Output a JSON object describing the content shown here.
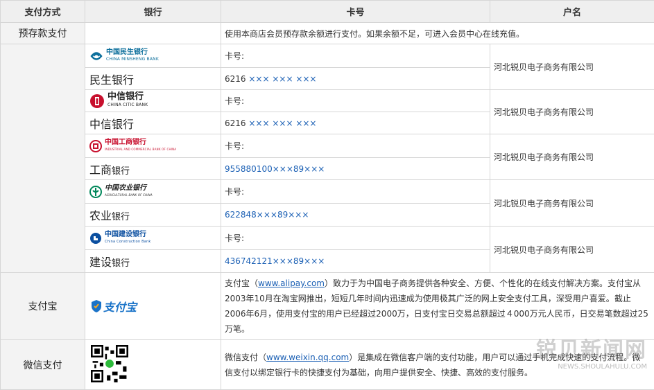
{
  "headers": [
    "支付方式",
    "银行",
    "卡号",
    "户名"
  ],
  "prepaid": {
    "method": "预存款支付",
    "desc": "使用本商店会员预存款余额进行支付。如果余额不足，可进入会员中心在线充值。"
  },
  "card_label": "卡号:",
  "banks": [
    {
      "logo_cn": "中国民生银行",
      "logo_en": "CHINA MINSHENG BANK",
      "name_big": "民生",
      "name_small": "银行",
      "card_prefix": "6216 ",
      "card_mask": "××× ××× ×××",
      "company": "河北锐贝电子商务有限公司",
      "color": "#0b6e9b"
    },
    {
      "logo_cn": "中信银行",
      "logo_en": "CHINA CITIC BANK",
      "name_big": "中信",
      "name_small": "银行",
      "card_prefix": "6216 ",
      "card_mask": "××× ××× ×××",
      "company": "河北锐贝电子商务有限公司",
      "color": "#c8102e"
    },
    {
      "logo_cn": "中国工商银行",
      "logo_en": "INDUSTRIAL AND COMMERCIAL BANK OF CHINA",
      "name_big": "工商",
      "name_small": "银行",
      "card_prefix": "",
      "card_mask": "955880100×××89×××",
      "company": "河北锐贝电子商务有限公司",
      "color": "#c8102e"
    },
    {
      "logo_cn": "中国农业银行",
      "logo_en": "AGRICULTURAL BANK OF CHINA",
      "name_big": "农业",
      "name_small": "银行",
      "card_prefix": "",
      "card_mask": "622848×××89×××",
      "company": "河北锐贝电子商务有限公司",
      "color": "#00875a"
    },
    {
      "logo_cn": "中国建设银行",
      "logo_en": "China Construction Bank",
      "name_big": "建设",
      "name_small": "银行",
      "card_prefix": "",
      "card_mask": "436742121×××89×××",
      "company": "河北锐贝电子商务有限公司",
      "color": "#0b4fa0"
    }
  ],
  "alipay": {
    "method": "支付宝",
    "logo_text": "支付宝",
    "desc_pre": "支付宝（",
    "link": "www.alipay.com",
    "desc_post": "）致力于为中国电子商务提供各种安全、方便、个性化的在线支付解决方案。支付宝从2003年10月在淘宝网推出，短短几年时间内迅速成为使用极其广泛的网上安全支付工具，深受用户喜爱。截止2006年6月，使用支付宝的用户已经超过2000万，日支付宝日交易总额超过４000万元人民币，日交易笔数超过25万笔。"
  },
  "wechat": {
    "method": "微信支付",
    "desc_pre": "微信支付（",
    "link": "www.weixin.qq.com",
    "desc_post": "）是集成在微信客户端的支付功能，用户可以通过手机完成快速的支付流程。微信支付以绑定银行卡的快捷支付为基础，向用户提供安全、快捷、高效的支付服务。"
  },
  "watermark": {
    "main": "锐贝新闻网",
    "sub": "NEWS.SHOULAHULU.COM"
  }
}
